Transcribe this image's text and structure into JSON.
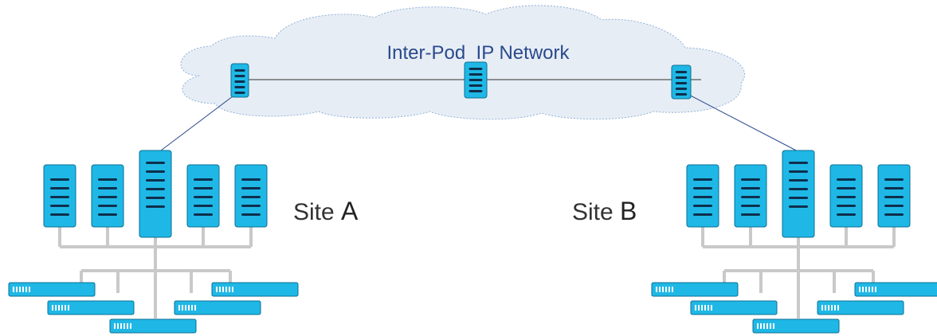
{
  "cloud": {
    "label": "Inter-Pod  IP Network"
  },
  "sites": [
    {
      "prefix": "Site ",
      "letter": "A"
    },
    {
      "prefix": "Site ",
      "letter": "B"
    }
  ],
  "colors": {
    "device_fill": "#1fb8e6",
    "device_stroke": "#0a6f94",
    "device_lines": "#0e2f4d",
    "cloud_fill": "#e7edf5",
    "cloud_stroke": "#8fb2d8",
    "cloud_text": "#2a4a8d",
    "link_line": "#2a4a8d",
    "fabric_line": "#c9c9c9",
    "site_text": "#333333"
  },
  "icons": {
    "cloud": "network-cloud-icon",
    "ipn_switch": "switch-icon",
    "spine": "spine-switch-icon",
    "leaf": "leaf-switch-icon",
    "server": "rack-server-icon"
  }
}
